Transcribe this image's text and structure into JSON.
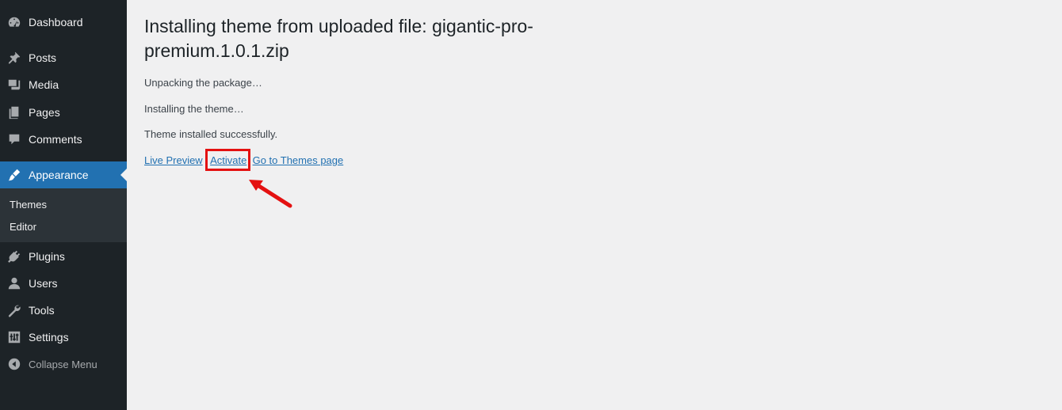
{
  "sidebar": {
    "items": [
      {
        "label": "Dashboard",
        "icon": "dashboard-icon"
      },
      {
        "label": "Posts",
        "icon": "pin-icon"
      },
      {
        "label": "Media",
        "icon": "media-icon"
      },
      {
        "label": "Pages",
        "icon": "pages-icon"
      },
      {
        "label": "Comments",
        "icon": "comment-icon"
      },
      {
        "label": "Appearance",
        "icon": "brush-icon",
        "active": true
      },
      {
        "label": "Plugins",
        "icon": "plug-icon"
      },
      {
        "label": "Users",
        "icon": "user-icon"
      },
      {
        "label": "Tools",
        "icon": "wrench-icon"
      },
      {
        "label": "Settings",
        "icon": "sliders-icon"
      },
      {
        "label": "Collapse Menu",
        "icon": "collapse-icon"
      }
    ],
    "submenu": [
      {
        "label": "Themes"
      },
      {
        "label": "Editor"
      }
    ]
  },
  "main": {
    "title": "Installing theme from uploaded file: gigantic-pro-premium.1.0.1.zip",
    "messages": [
      "Unpacking the package…",
      "Installing the theme…",
      "Theme installed successfully."
    ],
    "links": {
      "live_preview": "Live Preview",
      "separator": "|",
      "activate": "Activate",
      "themes_page": "Go to Themes page"
    }
  },
  "colors": {
    "sidebar_bg": "#1d2327",
    "submenu_bg": "#2c3338",
    "accent": "#2271b1",
    "highlight": "#e41111",
    "page_bg": "#f0f0f1"
  }
}
